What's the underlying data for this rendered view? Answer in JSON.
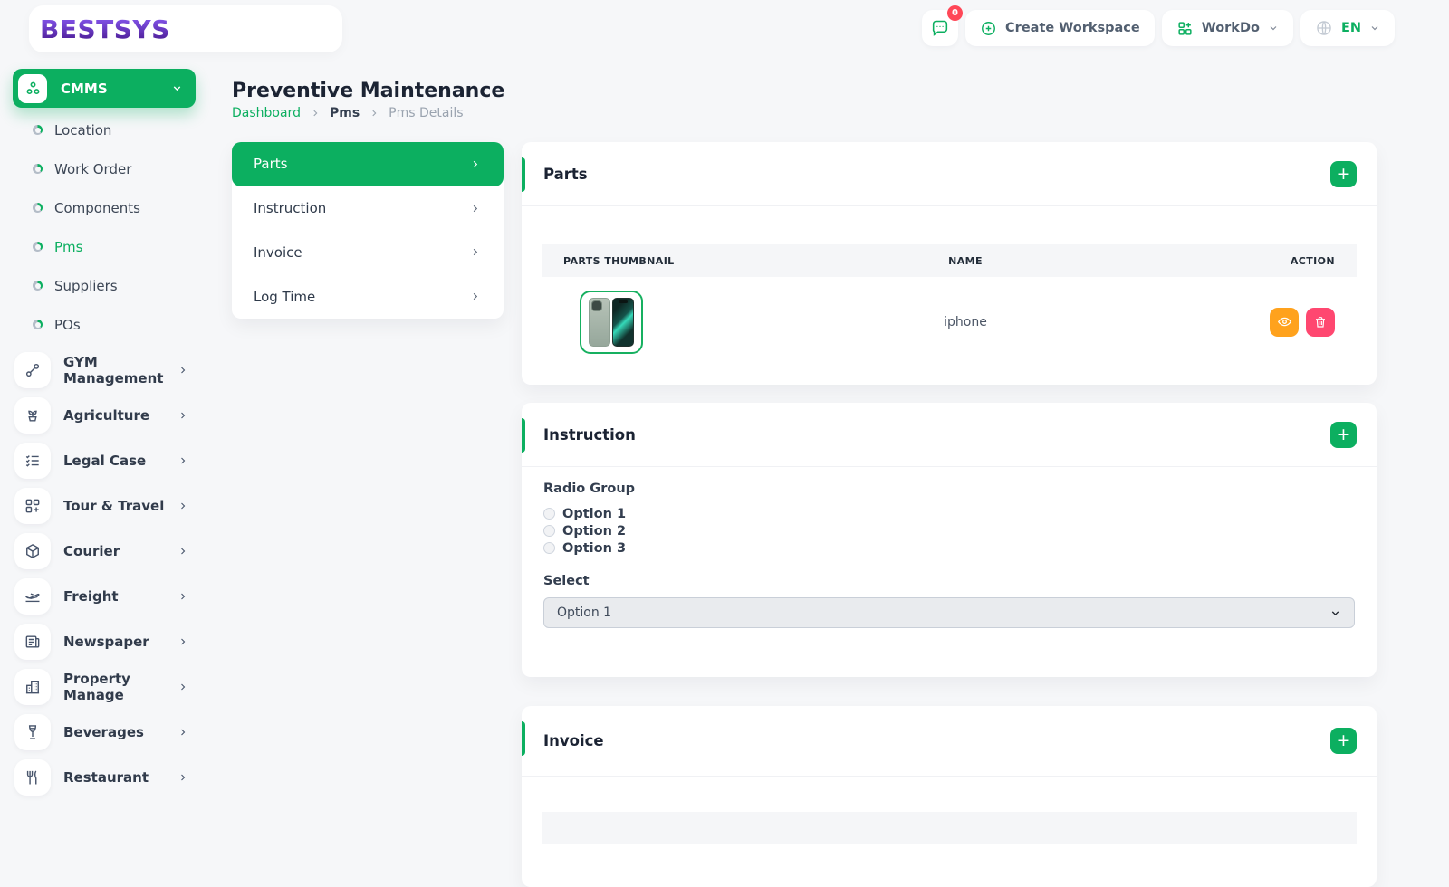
{
  "brand": {
    "name": "BESTSYS"
  },
  "header": {
    "notification_badge": "0",
    "create_workspace": "Create Workspace",
    "workspace": "WorkDo",
    "language": "EN"
  },
  "sidebar": {
    "module_switcher": "CMMS",
    "sub_items": [
      {
        "label": "Location"
      },
      {
        "label": "Work Order"
      },
      {
        "label": "Components"
      },
      {
        "label": "Pms"
      },
      {
        "label": "Suppliers"
      },
      {
        "label": "POs"
      }
    ],
    "modules": [
      {
        "label": "GYM Management"
      },
      {
        "label": "Agriculture"
      },
      {
        "label": "Legal Case"
      },
      {
        "label": "Tour & Travel"
      },
      {
        "label": "Courier"
      },
      {
        "label": "Freight"
      },
      {
        "label": "Newspaper"
      },
      {
        "label": "Property Manage"
      },
      {
        "label": "Beverages"
      },
      {
        "label": "Restaurant"
      }
    ]
  },
  "page": {
    "title": "Preventive Maintenance",
    "breadcrumb": {
      "home": "Dashboard",
      "section": "Pms",
      "current": "Pms Details"
    }
  },
  "tabs": [
    {
      "label": "Parts"
    },
    {
      "label": "Instruction"
    },
    {
      "label": "Invoice"
    },
    {
      "label": "Log Time"
    }
  ],
  "parts": {
    "title": "Parts",
    "add_label": "+",
    "columns": [
      "PARTS THUMBNAIL",
      "NAME",
      "ACTION"
    ],
    "rows": [
      {
        "name": "iphone"
      }
    ]
  },
  "instruction": {
    "title": "Instruction",
    "add_label": "+",
    "radio_group_label": "Radio Group",
    "options": [
      {
        "label": "Option 1"
      },
      {
        "label": "Option 2"
      },
      {
        "label": "Option 3"
      }
    ],
    "select_label": "Select",
    "select_value": "Option 1"
  },
  "invoice": {
    "title": "Invoice",
    "add_label": "+"
  },
  "colors": {
    "brand_green": "#0caf60",
    "view_orange": "#ffa21d",
    "delete_pink": "#ff4770",
    "badge_red": "#ff4757",
    "logo_purple": "#5b21b6"
  }
}
